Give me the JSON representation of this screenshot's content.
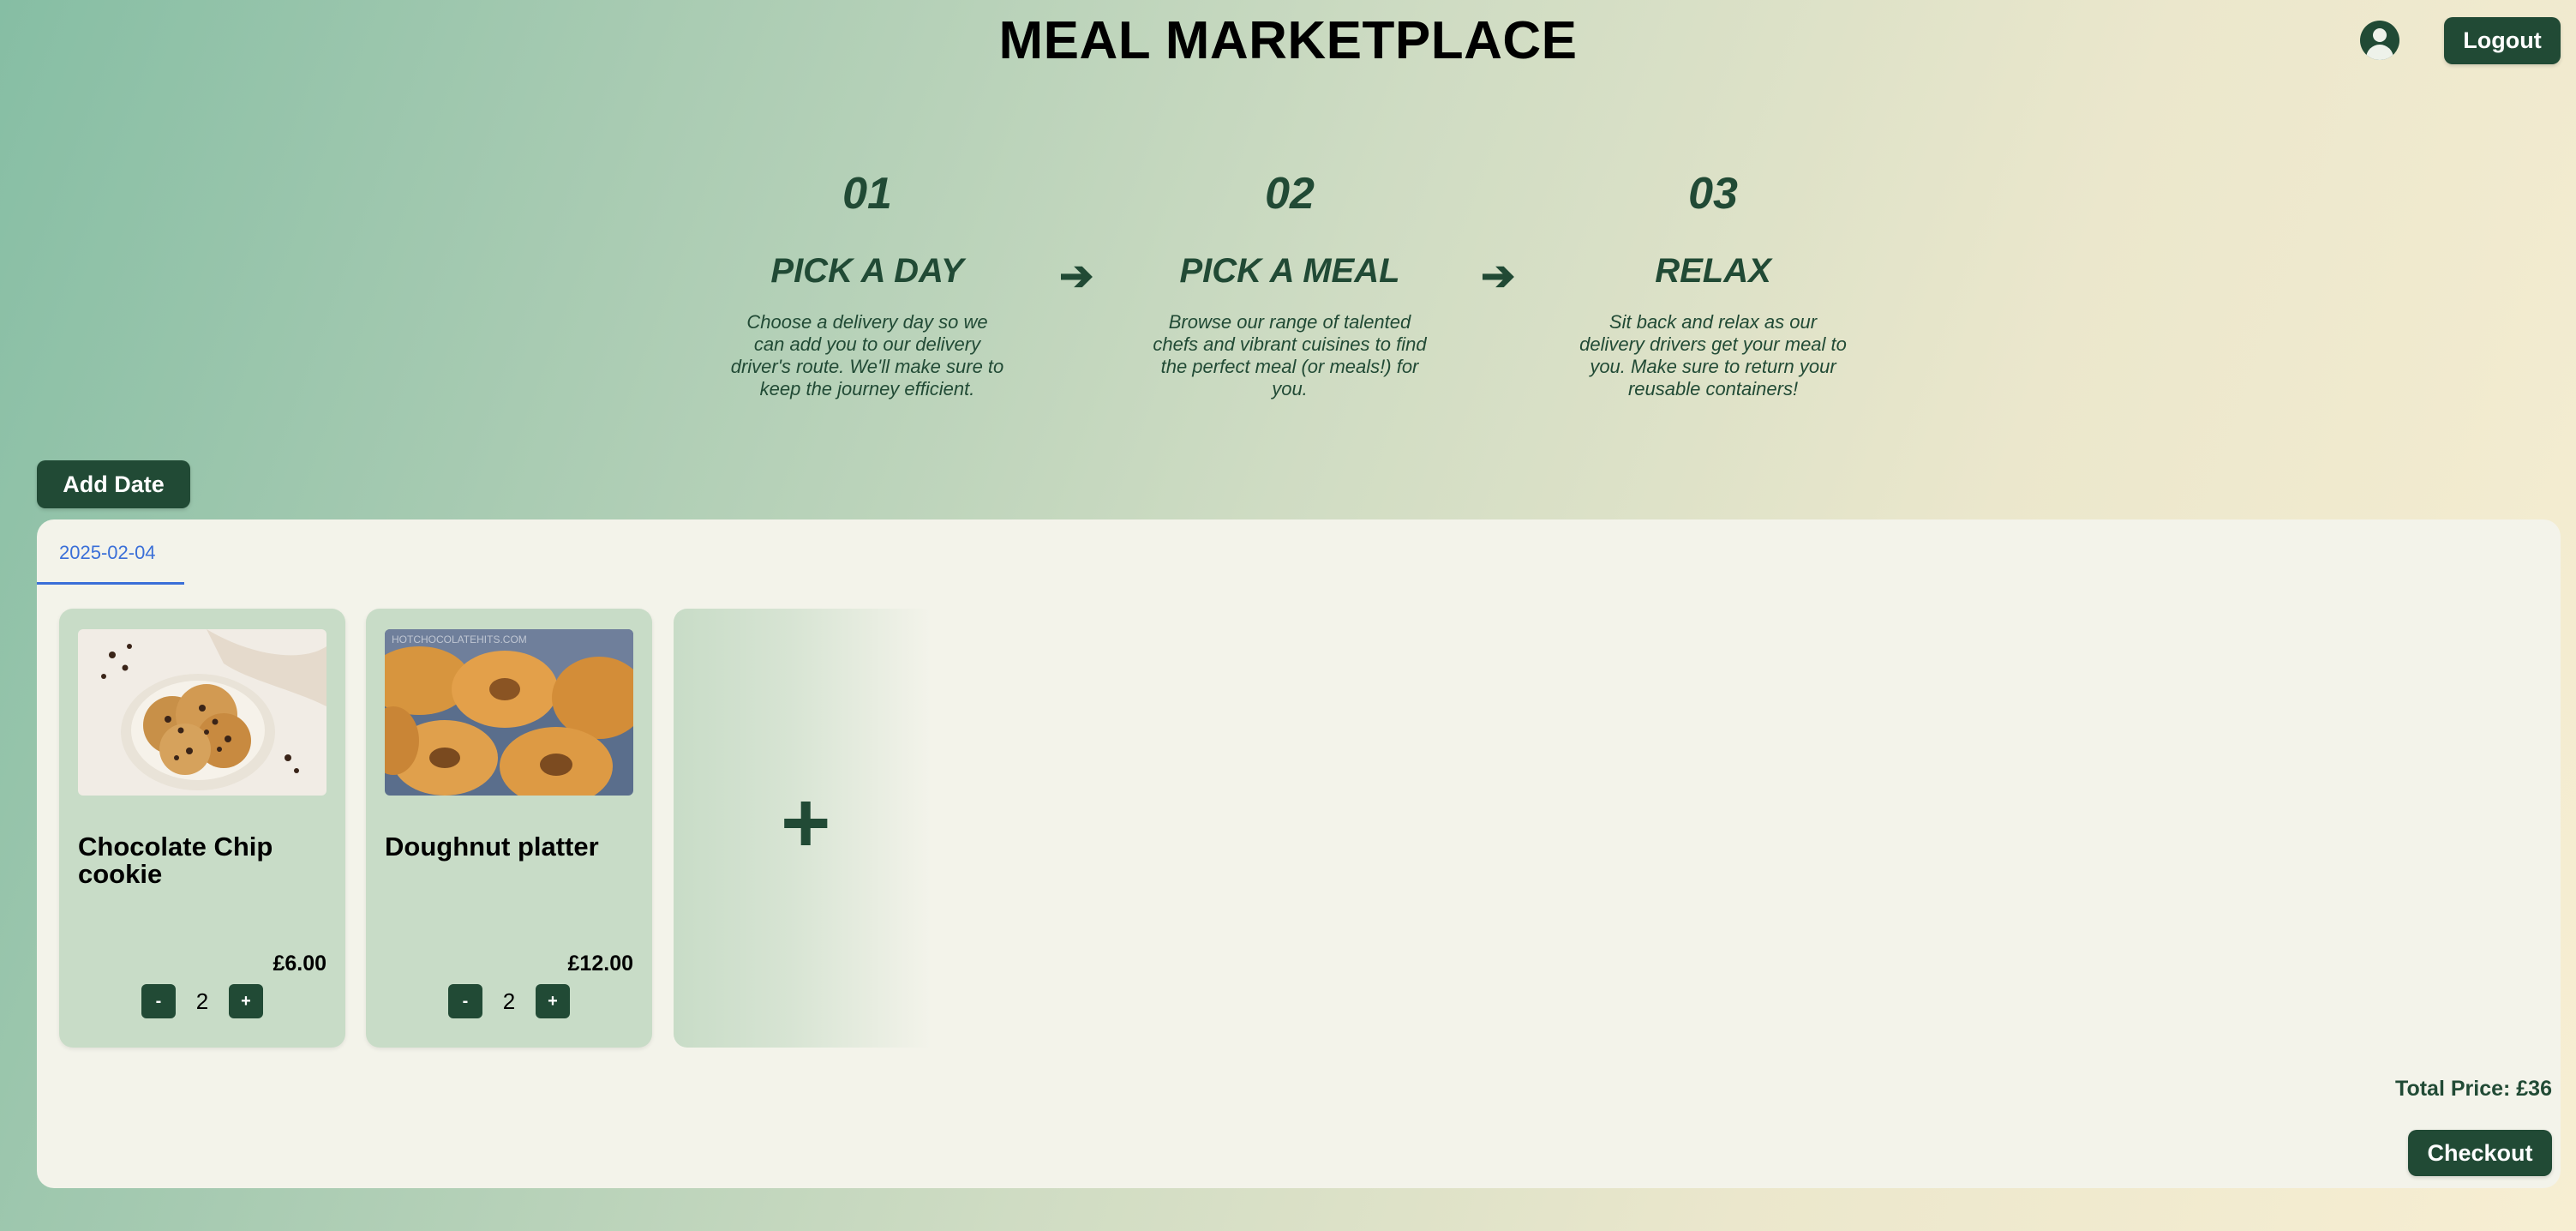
{
  "header": {
    "title": "MEAL MARKETPLACE",
    "logout_label": "Logout"
  },
  "steps": [
    {
      "number": "01",
      "title": "PICK A DAY",
      "description": "Choose a delivery day so we can add you to our delivery driver's route. We'll make sure to keep the journey efficient."
    },
    {
      "number": "02",
      "title": "PICK A MEAL",
      "description": "Browse our range of talented chefs and vibrant cuisines to find the perfect meal (or meals!) for you."
    },
    {
      "number": "03",
      "title": "RELAX",
      "description": "Sit back and relax as our delivery drivers get your meal to you. Make sure to return your reusable containers!"
    }
  ],
  "arrow_glyph": "➔",
  "add_date_label": "Add Date",
  "date_tab": "2025-02-04",
  "meals": [
    {
      "name": "Chocolate Chip cookie",
      "price": "£6.00",
      "quantity": "2",
      "minus": "-",
      "plus": "+"
    },
    {
      "name": "Doughnut platter",
      "price": "£12.00",
      "quantity": "2",
      "minus": "-",
      "plus": "+",
      "image_watermark": "HOTCHOCOLATEHITS.COM"
    }
  ],
  "add_meal_glyph": "+",
  "total_price": "Total Price: £36",
  "checkout_label": "Checkout",
  "colors": {
    "accent_dark_green": "#214a35",
    "tab_blue": "#3a6fd8",
    "card_green": "#c8dcc7",
    "panel_bg": "#f3f3ea"
  }
}
